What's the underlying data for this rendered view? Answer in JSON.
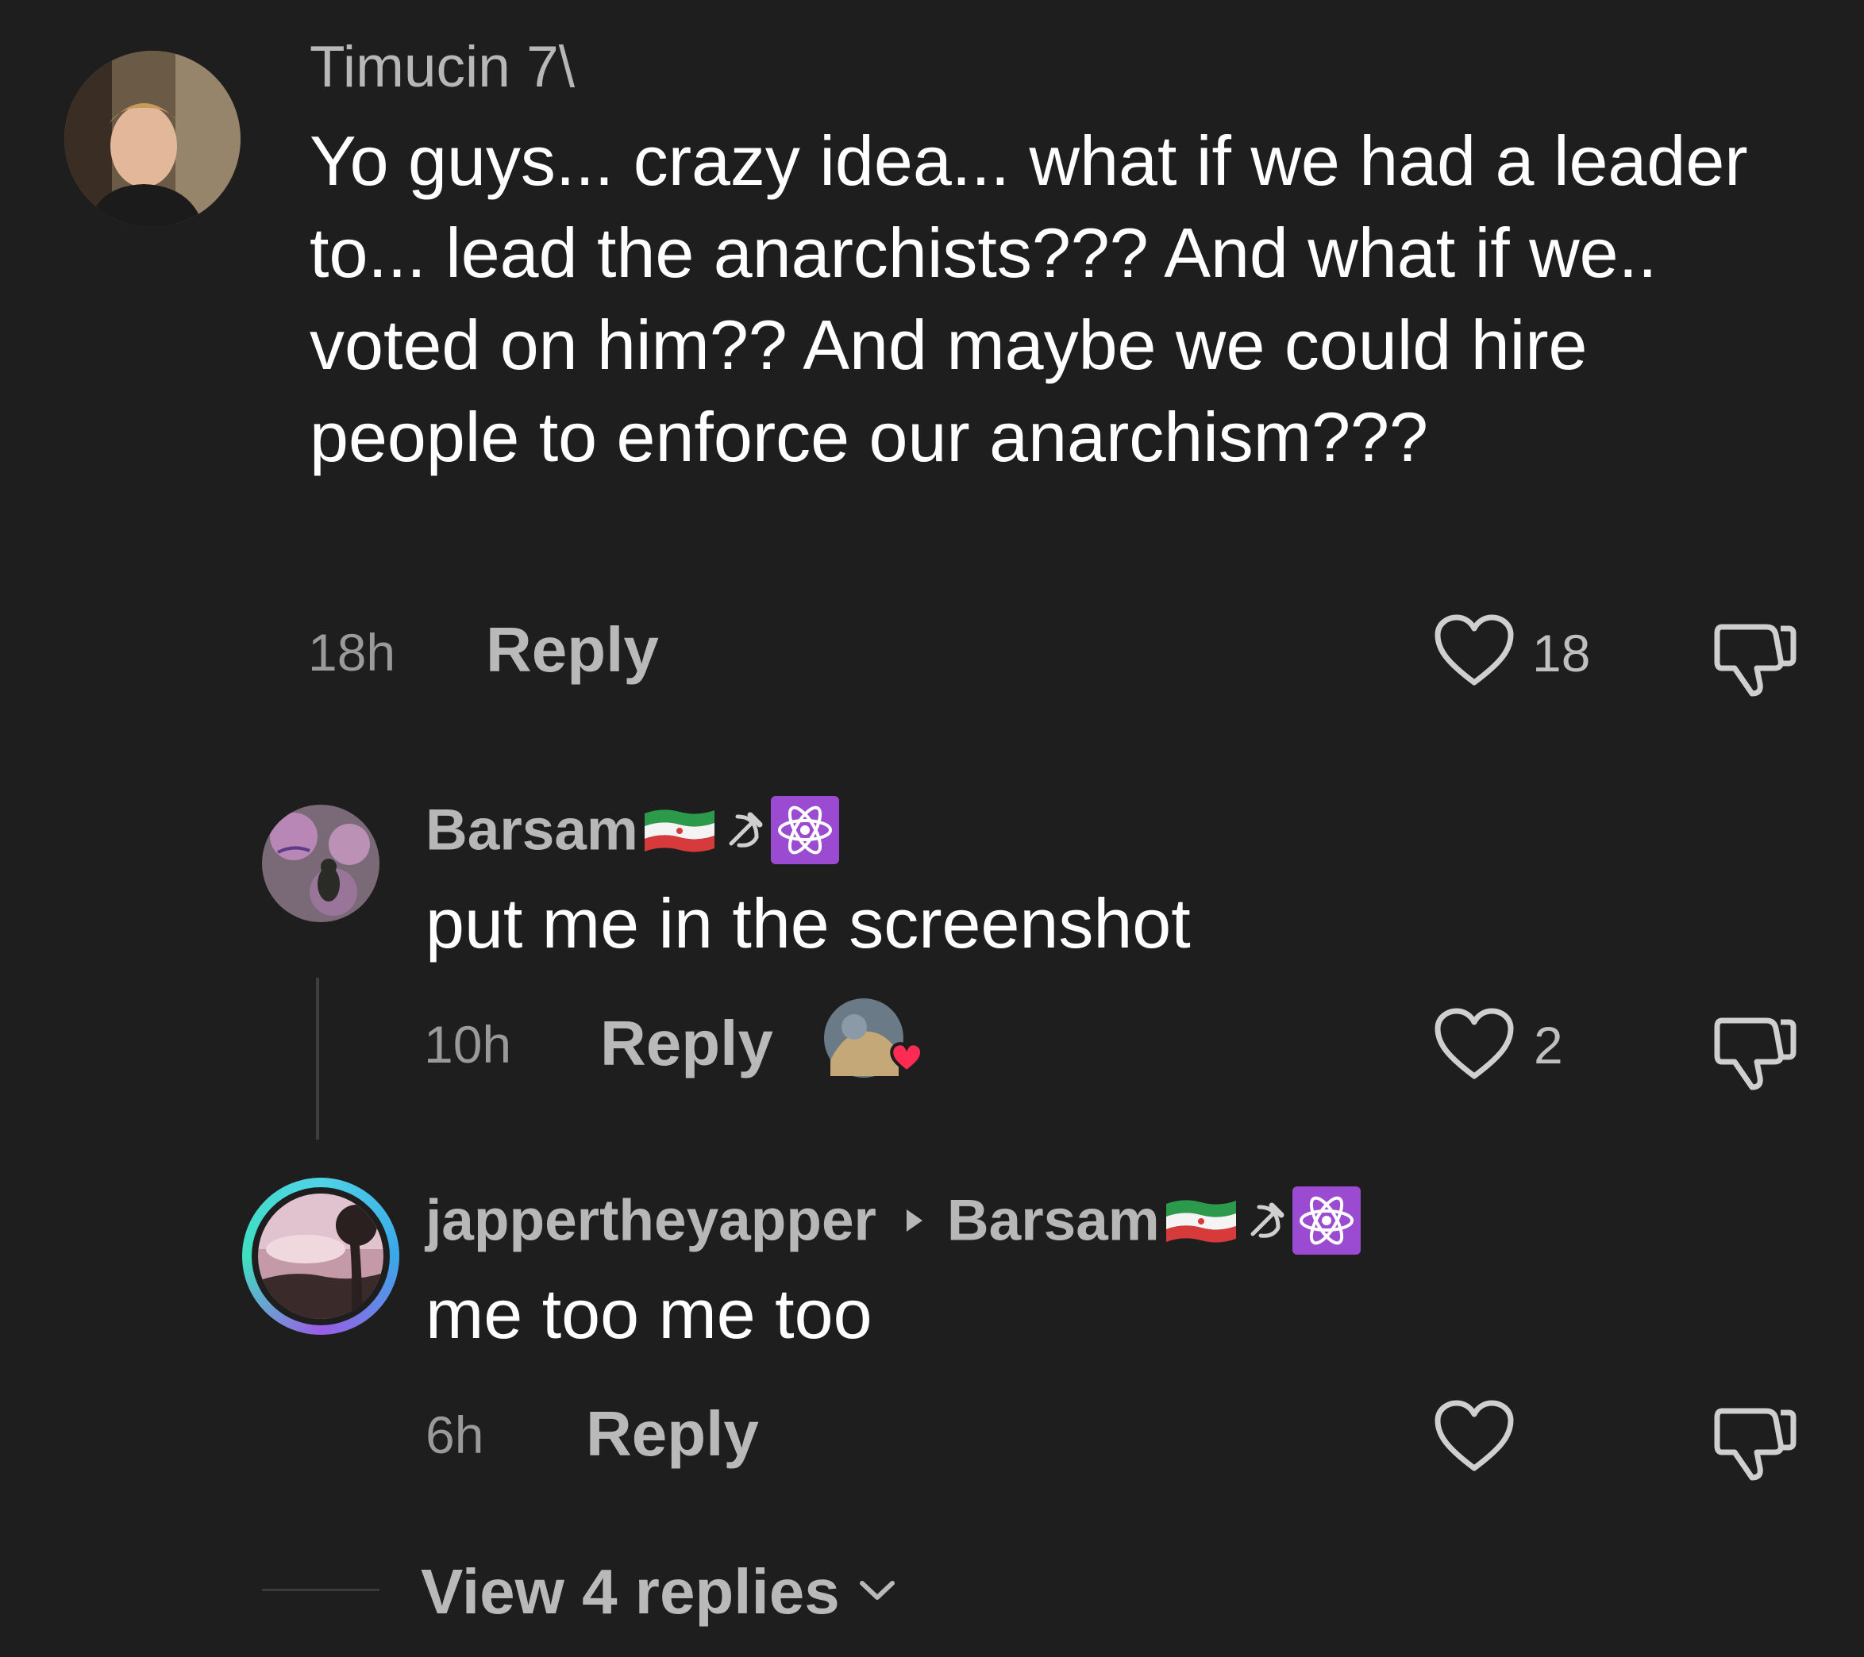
{
  "comments": [
    {
      "username": "Timucin 7\\",
      "text": "Yo guys... crazy idea... what if we had a leader to... lead the anarchists??? And what if we.. voted on him?? And maybe we could hire people to enforce our anarchism???",
      "time": "18h",
      "reply_label": "Reply",
      "likes": "18"
    },
    {
      "username": "Barsam",
      "text": "put me in the screenshot",
      "time": "10h",
      "reply_label": "Reply",
      "likes": "2"
    },
    {
      "username": "jappertheyapper",
      "reply_to": "Barsam",
      "text": "me too me too",
      "time": "6h",
      "reply_label": "Reply",
      "likes": ""
    }
  ],
  "view_replies": "View 4 replies",
  "icons": {
    "like": "heart-outline-icon",
    "dislike": "thumbs-down-icon",
    "expand": "chevron-down-icon",
    "reply_arrow": "caret-right-icon",
    "flag": "iran-flag-icon",
    "hammer_sickle": "hammer-sickle-icon",
    "atom": "atom-icon"
  },
  "colors": {
    "background": "#1e1e1e",
    "username": "#b7b7b7",
    "text": "#ffffff",
    "meta": "#9a9a9a",
    "like_reaction": "#fe2c55",
    "atom_badge": "#9b4bd1"
  }
}
